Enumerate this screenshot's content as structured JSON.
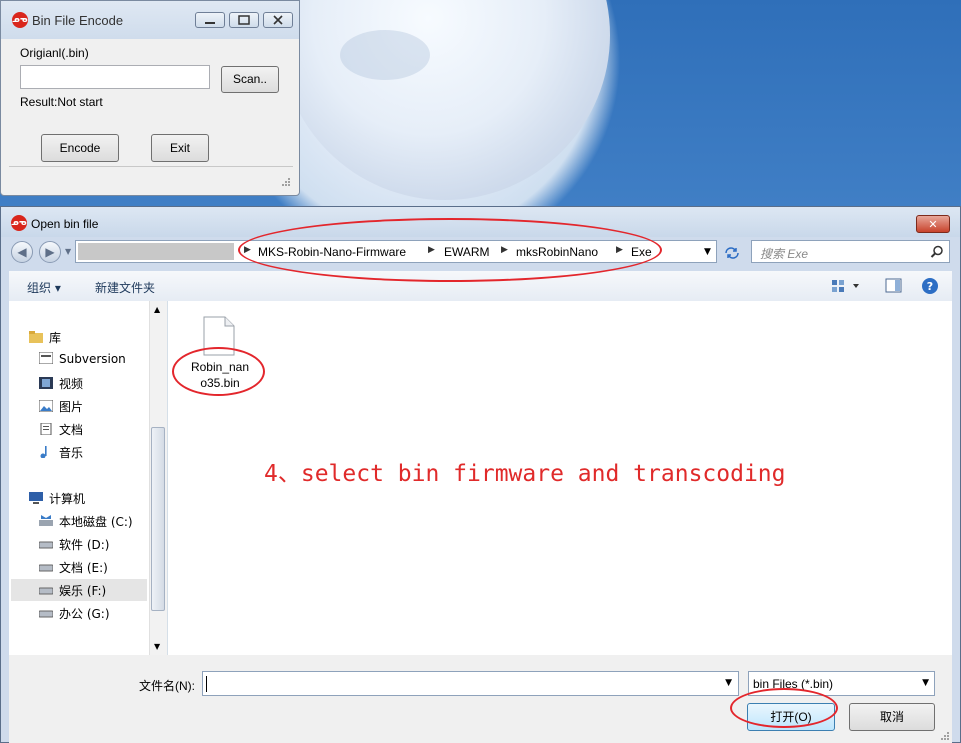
{
  "encoder": {
    "title": "Bin File Encode",
    "original_label": "Origianl(.bin)",
    "path_value": "",
    "scan_label": "Scan..",
    "result_label": "Result:Not start",
    "encode_label": "Encode",
    "exit_label": "Exit"
  },
  "dialog": {
    "title": "Open bin file",
    "breadcrumb": [
      "MKS-Robin-Nano-Firmware",
      "EWARM",
      "mksRobinNano",
      "Exe"
    ],
    "search_placeholder": "搜索 Exe",
    "toolbar": {
      "organize": "组织 ▾",
      "new_folder": "新建文件夹"
    },
    "nav": {
      "libraries": "库",
      "library_items": [
        "Subversion",
        "视频",
        "图片",
        "文档",
        "音乐"
      ],
      "computer": "计算机",
      "drives": [
        "本地磁盘 (C:)",
        "软件 (D:)",
        "文档 (E:)",
        "娱乐 (F:)",
        "办公 (G:)"
      ]
    },
    "files": [
      {
        "name_line1": "Robin_nan",
        "name_line2": "o35.bin"
      }
    ],
    "filename_label": "文件名(N):",
    "filename_value": "",
    "filter_value": "bin Files (*.bin)",
    "open_label": "打开(O)",
    "cancel_label": "取消"
  },
  "annotation": "4、select bin firmware and transcoding",
  "colors": {
    "annotation": "#e02a2a",
    "app_icon": "#d9261c",
    "close": "#c8432c"
  },
  "icons": [
    "app-logo-icon",
    "minimize-icon",
    "maximize-icon",
    "close-icon",
    "back-icon",
    "forward-icon",
    "refresh-icon",
    "search-icon",
    "view-icon",
    "preview-pane-icon",
    "help-icon",
    "folder-icon",
    "drive-icon",
    "computer-icon",
    "file-icon"
  ]
}
